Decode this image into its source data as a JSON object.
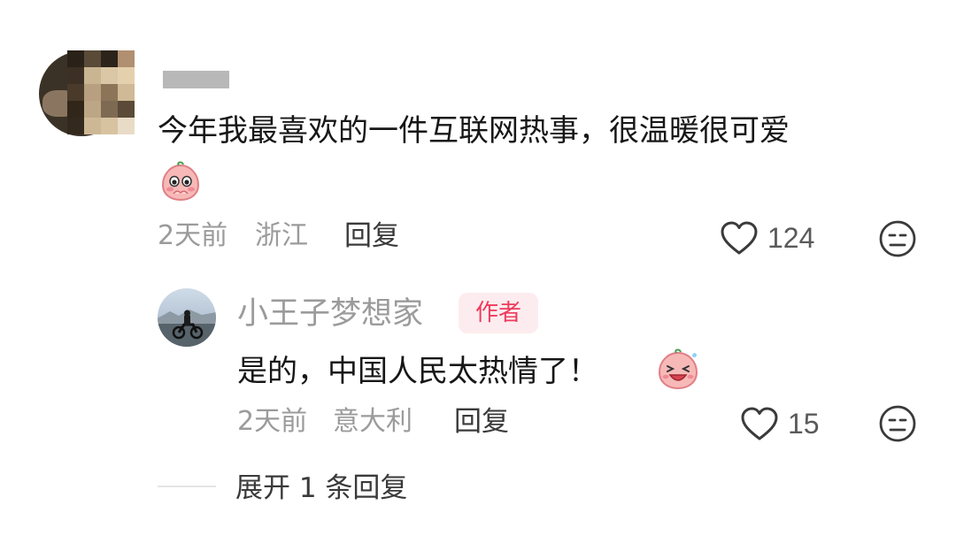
{
  "comment": {
    "text": "今年我最喜欢的一件互联网热事，很温暖很可爱",
    "sticker": "blushing-peach-sticker",
    "time": "2天前",
    "location": "浙江",
    "reply_label": "回复",
    "like_count": "124",
    "like_icon": "heart-outline-icon",
    "dislike_icon": "unamused-face-icon"
  },
  "reply": {
    "username": "小王子梦想家",
    "badge": "作者",
    "text": "是的，中国人民太热情了！",
    "sticker": "laughing-peach-sticker",
    "time": "2天前",
    "location": "意大利",
    "reply_label": "回复",
    "like_count": "15",
    "like_icon": "heart-outline-icon",
    "dislike_icon": "unamused-face-icon"
  },
  "expand": {
    "label": "展开 1 条回复"
  },
  "colors": {
    "meta_gray": "#9b9b9b",
    "badge_bg": "#fdecef",
    "badge_text": "#ee3b5c",
    "sticker_pink": "#f6b2b4"
  }
}
